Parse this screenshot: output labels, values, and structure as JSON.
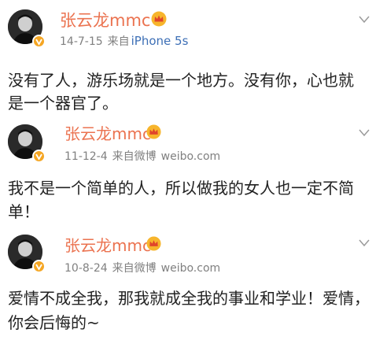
{
  "posts": [
    {
      "author": "张云龙mmc",
      "date": "14-7-15",
      "source_prefix": "来自",
      "source": "iPhone 5s",
      "lines": [
        "没有了人，游乐场就是一个地方。没有你，心也就",
        "是一个器官了。"
      ]
    },
    {
      "author": "张云龙mmc",
      "date": "11-12-4",
      "source_prefix": "来自微博",
      "source": "weibo.com",
      "lines": [
        "我不是一个简单的人，所以做我的女人也一定不简",
        "单！"
      ]
    },
    {
      "author": "张云龙mmc",
      "date": "10-8-24",
      "source_prefix": "来自微博",
      "source": "weibo.com",
      "lines": [
        "爱情不成全我，那我就成全我的事业和学业！爱情，",
        "你会后悔的~"
      ]
    }
  ],
  "colors": {
    "author": "#eb7350",
    "meta": "#808080",
    "iphone_source": "#3d6fb6",
    "verified_badge": "#f5a623",
    "crown": "#f7b52c"
  },
  "icons": {
    "verified": "verified-badge-icon",
    "member_crown": "crown-icon",
    "more": "chevron-down-icon"
  }
}
